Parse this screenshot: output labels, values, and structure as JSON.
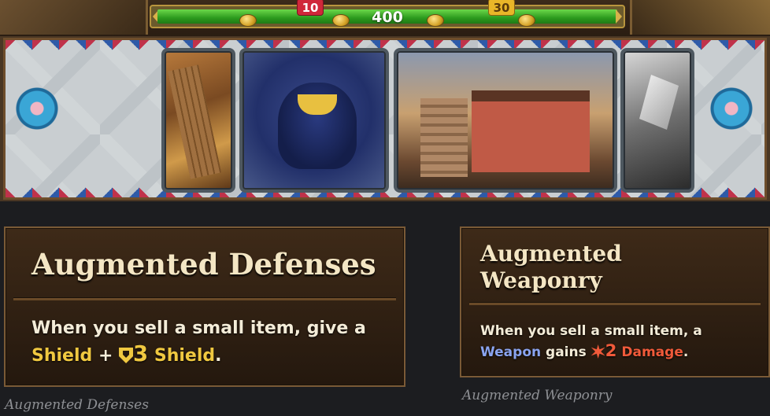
{
  "hud": {
    "gold_value": "400"
  },
  "shop": {
    "cards": [
      {
        "id": "plank-card"
      },
      {
        "id": "dog-card",
        "price": "10",
        "price_color": "#d0283a"
      },
      {
        "id": "house-card",
        "price": "30",
        "price_color": "#e9b628"
      },
      {
        "id": "knife-card"
      }
    ]
  },
  "tooltips": [
    {
      "title": "Augmented Defenses",
      "desc_part1": "When you sell a small item, give a",
      "keyword1": "Shield",
      "plus": "+",
      "amount": "3",
      "keyword2": "Shield",
      "end": ".",
      "caption": "Augmented Defenses"
    },
    {
      "title": "Augmented Weaponry",
      "desc_part1": "When you sell a small item, a",
      "keyword1": "Weapon",
      "middle": "gains",
      "amount": "2",
      "keyword2": "Damage",
      "end": ".",
      "caption": "Augmented Weaponry"
    }
  ],
  "colors": {
    "shield": "#f0c840",
    "weapon": "#8aa4f0",
    "damage": "#f05a3a",
    "gold_bar": "#2c9a1e"
  },
  "icons": [
    "coin-icon",
    "shield-icon",
    "damage-burst-icon",
    "fan-ornament-icon"
  ]
}
